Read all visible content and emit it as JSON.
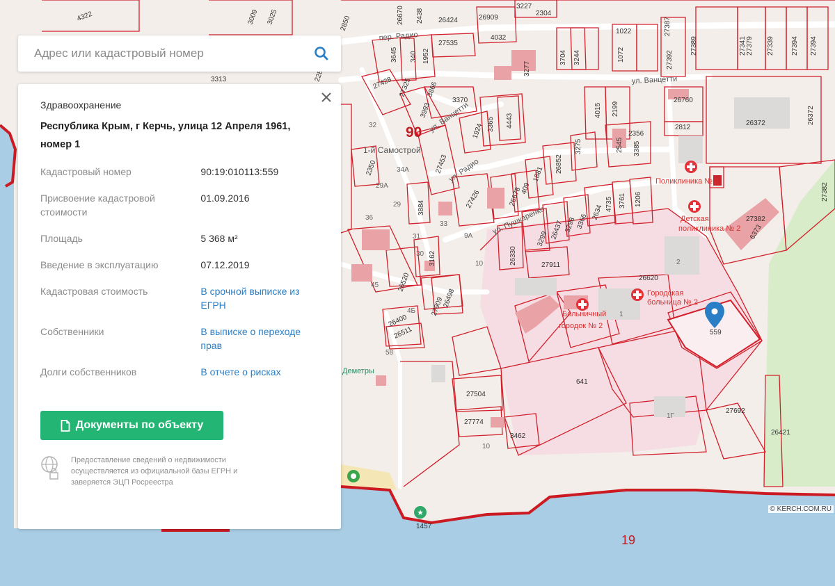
{
  "search": {
    "placeholder": "Адрес или кадастровый номер"
  },
  "info": {
    "category": "Здравоохранение",
    "address": "Республика Крым, г Керчь, улица 12 Апреля 1961, номер 1",
    "rows": [
      {
        "label": "Кадастровый номер",
        "value": "90:19:010113:559",
        "link": false
      },
      {
        "label": "Присвоение кадастровой стоимости",
        "value": "01.09.2016",
        "link": false
      },
      {
        "label": "Площадь",
        "value": "5 368 м²",
        "link": false
      },
      {
        "label": "Введение в эксплуатацию",
        "value": "07.12.2019",
        "link": false
      },
      {
        "label": "Кадастровая стоимость",
        "value": "В срочной выписке из ЕГРН",
        "link": true
      },
      {
        "label": "Собственники",
        "value": "В выписке о переходе прав",
        "link": true
      },
      {
        "label": "Долги собственников",
        "value": "В отчете о рисках",
        "link": true
      }
    ],
    "docs_button": "Документы по объекту",
    "note": "Предоставление сведений о недвижимости осуществляется из официальной базы ЕГРН и заверяется ЭЦП Росреестра"
  },
  "map": {
    "streets": [
      "пер. Радио",
      "ул. Ванцетти",
      "ул. Ванцетти",
      "ул. Радио",
      "ул. Пушкаренко",
      "1-й Самострой"
    ],
    "places": [
      "Поликлиника № 2",
      "Детская поликлиника № 2",
      "Городская больница № 2",
      "Больничный городок № 2",
      "Деметры"
    ],
    "parcels": [
      "26424",
      "27535",
      "26909",
      "4032",
      "3227",
      "2304",
      "1022",
      "1072",
      "27387",
      "27389",
      "27341",
      "27379",
      "27339",
      "27394",
      "27394",
      "3645",
      "340",
      "1952",
      "3704",
      "3244",
      "3277",
      "27392",
      "27428",
      "27325",
      "3866",
      "3370",
      "3993",
      "1924",
      "3365",
      "4443",
      "26760",
      "26372",
      "26372",
      "2812",
      "4015",
      "2199",
      "2356",
      "2545",
      "3385",
      "3275",
      "26852",
      "27453",
      "2350",
      "1881",
      "409",
      "26678",
      "27426",
      "3884",
      "4735",
      "3761",
      "1206",
      "2634",
      "3366",
      "3298",
      "26437",
      "3299",
      "26330",
      "27911",
      "3162",
      "26520",
      "26498",
      "27909",
      "26400",
      "26511",
      "26620",
      "641",
      "27504",
      "27774",
      "3462",
      "27692",
      "26421",
      "27382",
      "6373",
      "559",
      "1457",
      "3313",
      "3009",
      "3025",
      "4322",
      "2850",
      "2438",
      "26670",
      "2282",
      "27382"
    ],
    "quarter_label": "90",
    "sea_number": "19",
    "house_numbers": [
      "32",
      "34А",
      "29А",
      "29",
      "36",
      "31",
      "9А",
      "10",
      "45",
      "4Б",
      "58",
      "2",
      "1",
      "1Г",
      "10",
      "30",
      "33"
    ],
    "attribution": "© KERCH.COM.RU",
    "colors": {
      "parcel": "#d21f2a",
      "hospital_zone": "#f6dee4",
      "park": "#d8ecc8",
      "sea": "#a7cde6",
      "coast": "#cc1a22",
      "marker": "#2a7ec6"
    }
  }
}
